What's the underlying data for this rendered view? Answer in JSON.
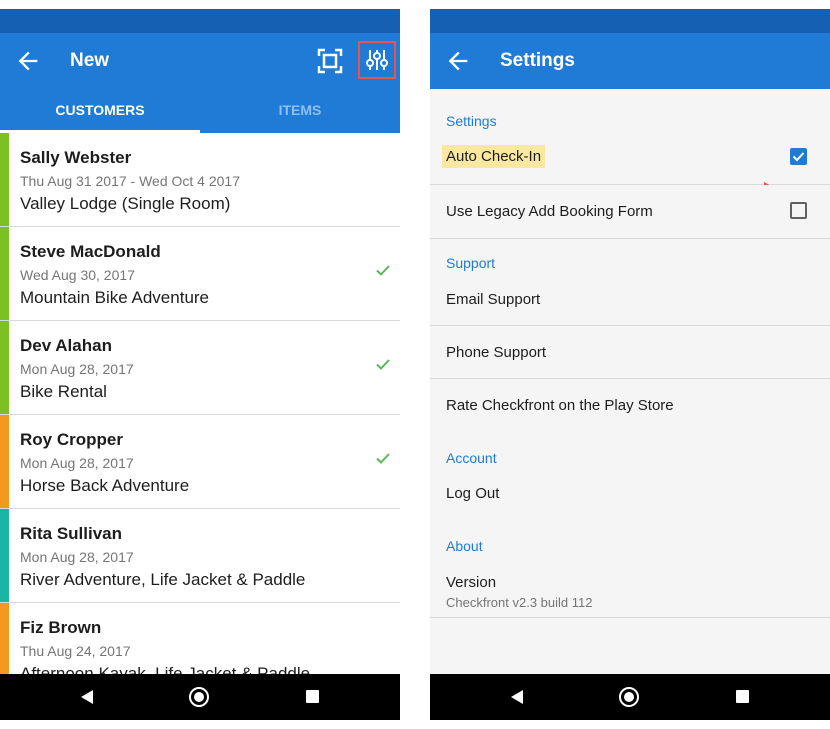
{
  "left_screen": {
    "appbar": {
      "title": "New"
    },
    "tabs": [
      {
        "label": "CUSTOMERS",
        "selected": true
      },
      {
        "label": "ITEMS",
        "selected": false
      }
    ],
    "customers": [
      {
        "name": "Sally Webster",
        "date": "Thu Aug 31 2017 - Wed Oct 4 2017",
        "item": "Valley Lodge (Single Room)",
        "stripe_color": "#7cc123",
        "checked_in": false
      },
      {
        "name": "Steve MacDonald",
        "date": "Wed Aug 30, 2017",
        "item": "Mountain Bike Adventure",
        "stripe_color": "#7cc123",
        "checked_in": true
      },
      {
        "name": "Dev Alahan",
        "date": "Mon Aug 28, 2017",
        "item": "Bike Rental",
        "stripe_color": "#7cc123",
        "checked_in": true
      },
      {
        "name": "Roy Cropper",
        "date": "Mon Aug 28, 2017",
        "item": "Horse Back Adventure",
        "stripe_color": "#f39a1e",
        "checked_in": true
      },
      {
        "name": "Rita Sullivan",
        "date": "Mon Aug 28, 2017",
        "item": "River Adventure, Life Jacket & Paddle",
        "stripe_color": "#18b5a4",
        "checked_in": false
      },
      {
        "name": "Fiz Brown",
        "date": "Thu Aug 24, 2017",
        "item": "Afternoon Kayak, Life Jacket & Paddle",
        "stripe_color": "#f39a1e",
        "checked_in": false
      }
    ]
  },
  "right_screen": {
    "appbar": {
      "title": "Settings"
    },
    "sections": {
      "settings": "Settings",
      "support": "Support",
      "account": "Account",
      "about": "About"
    },
    "items": {
      "auto_checkin": {
        "label": "Auto Check-In",
        "checked": true
      },
      "legacy_form": {
        "label": "Use Legacy Add Booking Form",
        "checked": false
      },
      "email_support": "Email Support",
      "phone_support": "Phone Support",
      "rate": "Rate Checkfront on the Play Store",
      "logout": "Log Out",
      "version_label": "Version",
      "version_value": "Checkfront v2.3 build 112"
    }
  },
  "colors": {
    "primary": "#1f7bd6",
    "status_bar": "#1560b2",
    "check_green": "#5cb85c",
    "annotation_red": "#e8534a",
    "highlight_yellow": "#fbe8a0"
  },
  "icons": [
    "arrow-back-icon",
    "scan-icon",
    "filter-sliders-icon",
    "check-icon",
    "nav-back-icon",
    "nav-home-icon",
    "nav-recent-icon",
    "annotation-arrow-icon"
  ]
}
